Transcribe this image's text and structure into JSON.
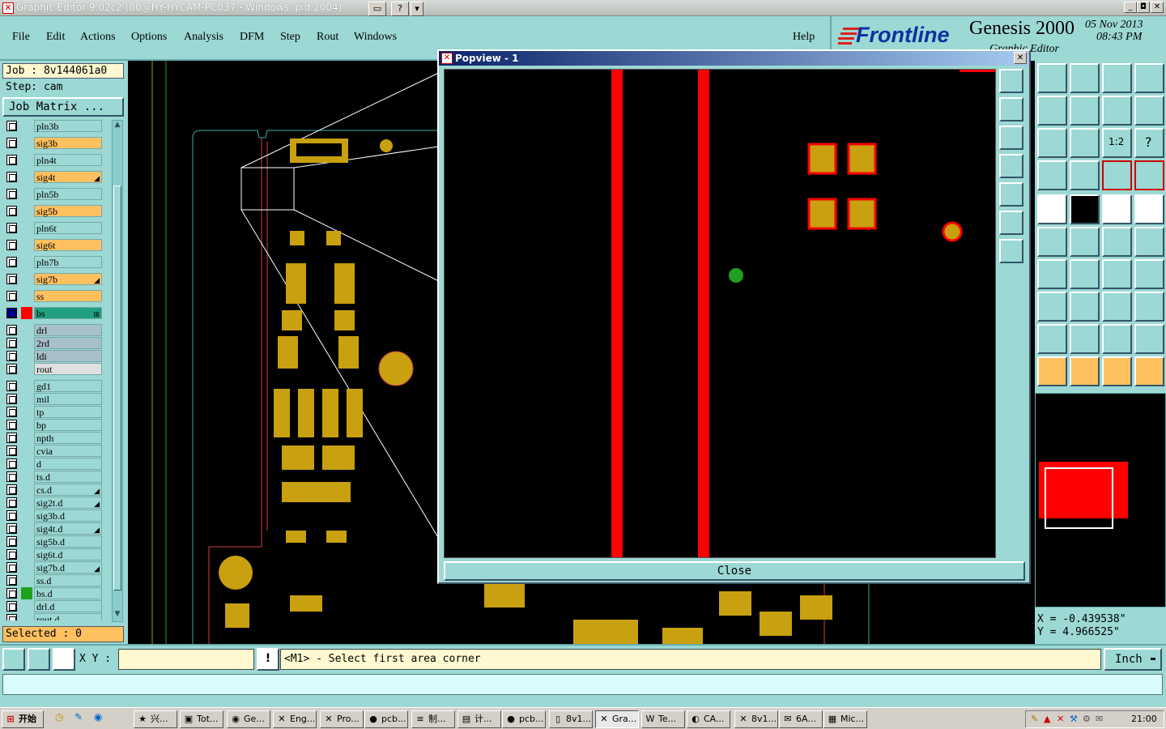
{
  "window": {
    "title": "Graphic Editor 9.02c2 (00@HY-HYCAM-PC037 - Windows, pid:2004)",
    "buttons": [
      "▭",
      "?",
      "▾"
    ],
    "controls": [
      "_",
      "◘",
      "✕"
    ]
  },
  "menu": {
    "items": [
      "File",
      "Edit",
      "Actions",
      "Options",
      "Analysis",
      "DFM",
      "Step",
      "Rout",
      "Windows"
    ],
    "help": "Help"
  },
  "brand": {
    "logo": "Frontline",
    "product": "Genesis 2000",
    "date": "05 Nov 2013",
    "time": "08:43 PM",
    "subtitle_partial": "Graphic Editor"
  },
  "job": {
    "job_label": "Job : 8v144061a0",
    "step_label": "Step: cam",
    "matrix_button": "Job Matrix ..."
  },
  "layers": [
    {
      "name": "pln3b",
      "color": "#9cd8d4",
      "mark": ""
    },
    {
      "name": "sig3b",
      "color": "#ffc060",
      "mark": ""
    },
    {
      "name": "pln4t",
      "color": "#9cd8d4",
      "mark": ""
    },
    {
      "name": "sig4t",
      "color": "#ffc060",
      "mark": "◢"
    },
    {
      "name": "pln5b",
      "color": "#9cd8d4",
      "mark": ""
    },
    {
      "name": "sig5b",
      "color": "#ffc060",
      "mark": ""
    },
    {
      "name": "pln6t",
      "color": "#9cd8d4",
      "mark": ""
    },
    {
      "name": "sig6t",
      "color": "#ffc060",
      "mark": ""
    },
    {
      "name": "pln7b",
      "color": "#9cd8d4",
      "mark": ""
    },
    {
      "name": "sig7b",
      "color": "#ffc060",
      "mark": "◢"
    },
    {
      "name": "ss",
      "color": "#ffc060",
      "mark": ""
    },
    {
      "name": "bs",
      "color": "#20a080",
      "mark": "⊞"
    },
    {
      "name": "drl",
      "color": "#a8c0c8",
      "mark": ""
    },
    {
      "name": "2rd",
      "color": "#a8c0c8",
      "mark": ""
    },
    {
      "name": "ldi",
      "color": "#a8c0c8",
      "mark": ""
    },
    {
      "name": "rout",
      "color": "#e0e0e0",
      "mark": ""
    },
    {
      "name": "gd1",
      "color": "#9cd8d4",
      "mark": ""
    },
    {
      "name": "mil",
      "color": "#9cd8d4",
      "mark": ""
    },
    {
      "name": "tp",
      "color": "#9cd8d4",
      "mark": ""
    },
    {
      "name": "bp",
      "color": "#9cd8d4",
      "mark": ""
    },
    {
      "name": "npth",
      "color": "#9cd8d4",
      "mark": ""
    },
    {
      "name": "cvia",
      "color": "#9cd8d4",
      "mark": ""
    },
    {
      "name": "d",
      "color": "#9cd8d4",
      "mark": ""
    },
    {
      "name": "ts.d",
      "color": "#9cd8d4",
      "mark": ""
    },
    {
      "name": "cs.d",
      "color": "#9cd8d4",
      "mark": "◢"
    },
    {
      "name": "sig2t.d",
      "color": "#9cd8d4",
      "mark": "◢"
    },
    {
      "name": "sig3b.d",
      "color": "#9cd8d4",
      "mark": ""
    },
    {
      "name": "sig4t.d",
      "color": "#9cd8d4",
      "mark": "◢"
    },
    {
      "name": "sig5b.d",
      "color": "#9cd8d4",
      "mark": ""
    },
    {
      "name": "sig6t.d",
      "color": "#9cd8d4",
      "mark": ""
    },
    {
      "name": "sig7b.d",
      "color": "#9cd8d4",
      "mark": "◢"
    },
    {
      "name": "ss.d",
      "color": "#9cd8d4",
      "mark": ""
    },
    {
      "name": "bs.d",
      "color": "#9cd8d4",
      "mark": ""
    },
    {
      "name": "drl.d",
      "color": "#9cd8d4",
      "mark": ""
    },
    {
      "name": "rout.d",
      "color": "#9cd8d4",
      "mark": ""
    }
  ],
  "selected": "Selected : 0",
  "popview": {
    "title": "Popview - 1",
    "close_x": "✕",
    "close_button": "Close"
  },
  "coords": {
    "x": "X = -0.439538\"",
    "y": "Y = 4.966525\""
  },
  "bottom": {
    "xy_label": "X Y :",
    "info_icon": "!",
    "status": "<M1> - Select first area corner",
    "unit": "Inch"
  },
  "taskbar": {
    "start": "开始",
    "tasks": [
      {
        "label": "兴...",
        "icon": "★"
      },
      {
        "label": "Tot...",
        "icon": "▣"
      },
      {
        "label": "Ge...",
        "icon": "◉"
      },
      {
        "label": "Eng...",
        "icon": "✕"
      },
      {
        "label": "Pro...",
        "icon": "✕"
      },
      {
        "label": "pcb...",
        "icon": "●"
      },
      {
        "label": "制...",
        "icon": "≡"
      },
      {
        "label": "计...",
        "icon": "▤"
      },
      {
        "label": "pcb...",
        "icon": "●"
      },
      {
        "label": "8v1...",
        "icon": "▯"
      },
      {
        "label": "Gra...",
        "icon": "✕"
      },
      {
        "label": "Te...",
        "icon": "W"
      },
      {
        "label": "CA...",
        "icon": "◐"
      },
      {
        "label": "8v1...",
        "icon": "✕"
      },
      {
        "label": "6A...",
        "icon": "✉"
      },
      {
        "label": "Mic...",
        "icon": "▦"
      }
    ],
    "clock": "21:00"
  },
  "colors": {
    "panel": "#9cd8d4",
    "highlight": "#ffc060",
    "pad": "#c8a010",
    "trace": "#ff0000"
  }
}
